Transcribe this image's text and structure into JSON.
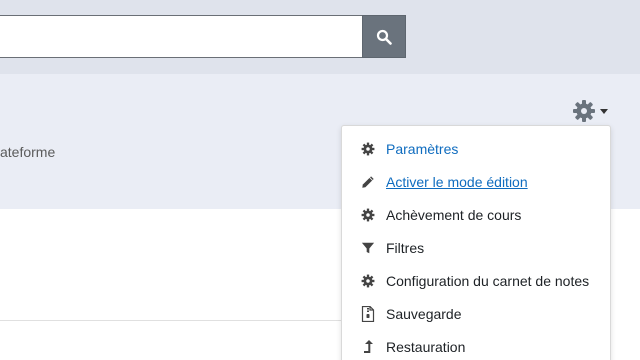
{
  "search": {
    "value": "",
    "placeholder": ""
  },
  "header": {
    "subtitle": "ateforme"
  },
  "menu": {
    "items": [
      {
        "label": "Paramètres",
        "icon": "gear-icon"
      },
      {
        "label": "Activer le mode édition",
        "icon": "pencil-icon"
      },
      {
        "label": "Achèvement de cours",
        "icon": "gear-icon"
      },
      {
        "label": "Filtres",
        "icon": "filter-icon"
      },
      {
        "label": "Configuration du carnet de notes",
        "icon": "gear-icon"
      },
      {
        "label": "Sauvegarde",
        "icon": "file-archive-icon"
      },
      {
        "label": "Restauration",
        "icon": "level-up-icon"
      }
    ]
  },
  "colors": {
    "link": "#0f6cbf",
    "top_band": "#dfe3ec",
    "header_band": "#eaedf5",
    "search_button": "#6a737d"
  }
}
